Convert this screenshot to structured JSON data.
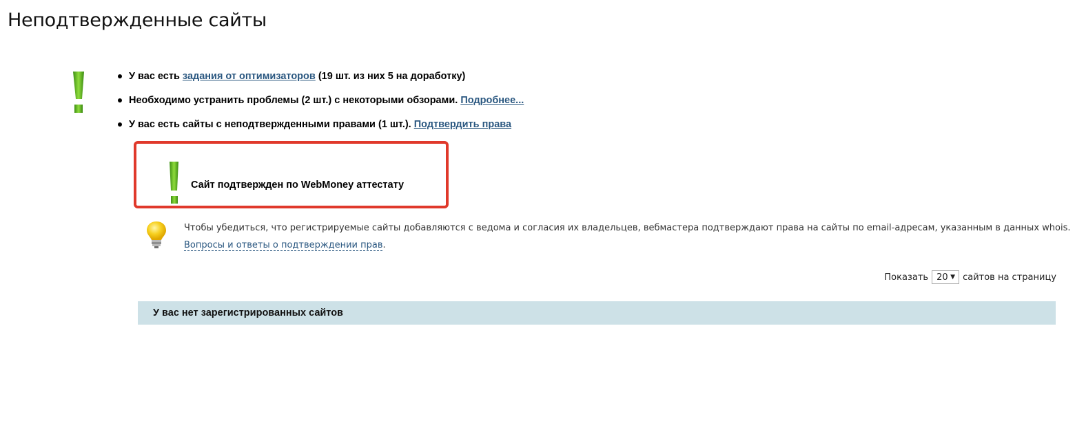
{
  "page": {
    "title": "Неподтвержденные сайты"
  },
  "notices": {
    "icon": "green-exclamation-icon",
    "items": [
      {
        "prefix": "У вас есть ",
        "link": "задания от оптимизаторов",
        "suffix": " (19 шт. из них 5 на доработку)"
      },
      {
        "prefix": "Необходимо устранить проблемы (2 шт.) с некоторыми обзорами. ",
        "link": "Подробнее...",
        "suffix": ""
      },
      {
        "prefix": "У вас есть сайты с неподтвержденными правами (1 шт.). ",
        "link": "Подтвердить права",
        "suffix": ""
      }
    ]
  },
  "highlight": {
    "icon": "green-exclamation-icon",
    "text": "Сайт подтвержден по WebMoney аттестату",
    "border_color": "#e0392b"
  },
  "info": {
    "icon": "lightbulb-icon",
    "text": "Чтобы убедиться, что регистрируемые сайты добавляются с ведома и согласия их владельцев, вебмастера подтверждают права на сайты по email-адресам, указанным в данных whois.",
    "link": "Вопросы и ответы о подтверждении прав",
    "link_suffix": "."
  },
  "pagination": {
    "label_before": "Показать",
    "selected": "20",
    "label_after": "сайтов на страницу"
  },
  "table": {
    "empty_message": "У вас нет зарегистрированных сайтов",
    "header_bg": "#cde1e7"
  },
  "colors": {
    "link": "#2a5780",
    "accent_green": "#5cb82a"
  }
}
